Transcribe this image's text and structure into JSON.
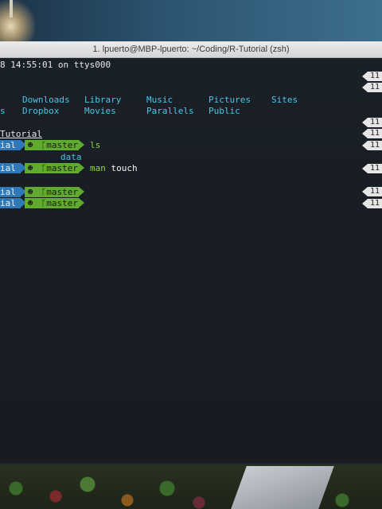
{
  "window": {
    "title": "1. lpuerto@MBP-lpuerto: ~/Coding/R-Tutorial (zsh)"
  },
  "terminal": {
    "login_line": "8 14:55:01 on ttys000",
    "ls_row1": [
      "Downloads",
      "Library",
      "Music",
      "Pictures",
      "Sites"
    ],
    "ls_row2": [
      "s",
      "Dropbox",
      "Movies",
      "Parallels",
      "Public"
    ],
    "cd_dir": "Tutorial",
    "prompt_dir": "ial",
    "git_branch": "master",
    "git_icon": "github-icon",
    "commands": [
      "ls",
      "",
      "man touch",
      "",
      ""
    ],
    "ls_output": "data",
    "time_badge": "11"
  },
  "colors": {
    "dir_segment": "#2f79b8",
    "git_segment": "#5faa2f",
    "directory_listing": "#4ac7e6",
    "time_badge": "#e6e6e6"
  }
}
